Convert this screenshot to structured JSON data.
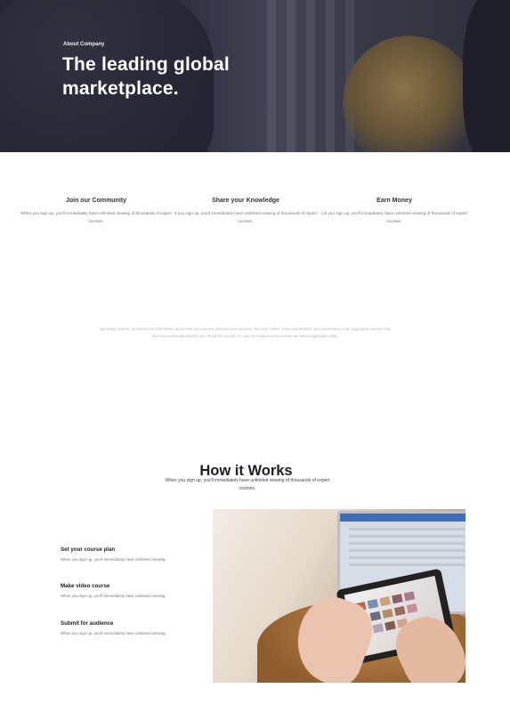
{
  "hero": {
    "eyebrow": "About Company",
    "title": "The leading global marketplace."
  },
  "features": [
    {
      "title": "Join our Community",
      "desc": "When you sign up, you'll immediately have unlimited viewing of thousands of expert courses."
    },
    {
      "title": "Share your Knowledge",
      "desc": "If you sign up, you'll immediately have unlimited viewing of thousands of expert courses."
    },
    {
      "title": "Earn Money",
      "desc": "Let you sign up, you'll immediately have unlimited viewing of thousands of expert courses."
    }
  ],
  "info": {
    "text": "Operating system, and technical information about how you use our products and services. We only collect, track and analyze such information in an aggregate manner that does not personally identify you. Read the section on Use on Cookies to know how we collect aggregate data."
  },
  "how": {
    "title": "How it Works",
    "subtitle": "When you sign up, you'll immediately have unlimited viewing of thousands of expert courses.",
    "steps": [
      {
        "title": "Set your course plan",
        "desc": "When you sign up, you'll immediately have unlimited viewing."
      },
      {
        "title": "Make video course",
        "desc": "When you sign up, you'll immediately have unlimited viewing."
      },
      {
        "title": "Submit for audience",
        "desc": "When you sign up, you'll immediately have unlimited viewing."
      }
    ]
  },
  "colors": {
    "hero_overlay": "#2c2f3e",
    "heading": "#1e1e28",
    "muted_text": "#777777",
    "faint_text": "#b8b8be"
  }
}
